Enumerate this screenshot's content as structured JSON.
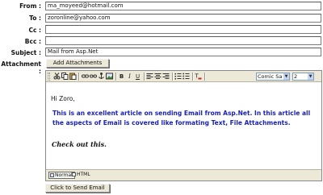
{
  "form": {
    "from_label": "From :",
    "from_value": "ma_moyeed@hotmail.com",
    "to_label": "To :",
    "to_value": "zoronline@yahoo.com",
    "cc_label": "Cc :",
    "cc_value": "",
    "bcc_label": "Bcc :",
    "bcc_value": "",
    "subject_label": "Subject :",
    "subject_value": "Mail from Asp.Net",
    "attachment_label": "Attachment :",
    "add_attachments_label": "Add Attachments"
  },
  "toolbar": {
    "icons": [
      "cut-icon",
      "copy-icon",
      "paste-icon",
      "link-icon",
      "unlink-icon",
      "anchor-icon",
      "image-icon",
      "bold-icon",
      "italic-icon",
      "underline-icon",
      "align-left-icon",
      "align-center-icon",
      "align-right-icon",
      "ordered-list-icon",
      "unordered-list-icon",
      "text-color-icon"
    ],
    "bold_glyph": "B",
    "italic_glyph": "I",
    "underline_glyph": "U",
    "font_value": "Comic Sa",
    "size_value": "2"
  },
  "editor": {
    "greeting": "Hi Zoro,",
    "paragraph": "This is an excellent article on sending Email from Asp.Net. In this article all the aspects of Email is covered like formating Text,  File Attachments.",
    "checkout": "Check out this.",
    "paragraph_color": "#1a22b8"
  },
  "modes": {
    "normal_label": "Normal",
    "html_label": "HTML"
  },
  "send_button_label": "Click to Send Email"
}
